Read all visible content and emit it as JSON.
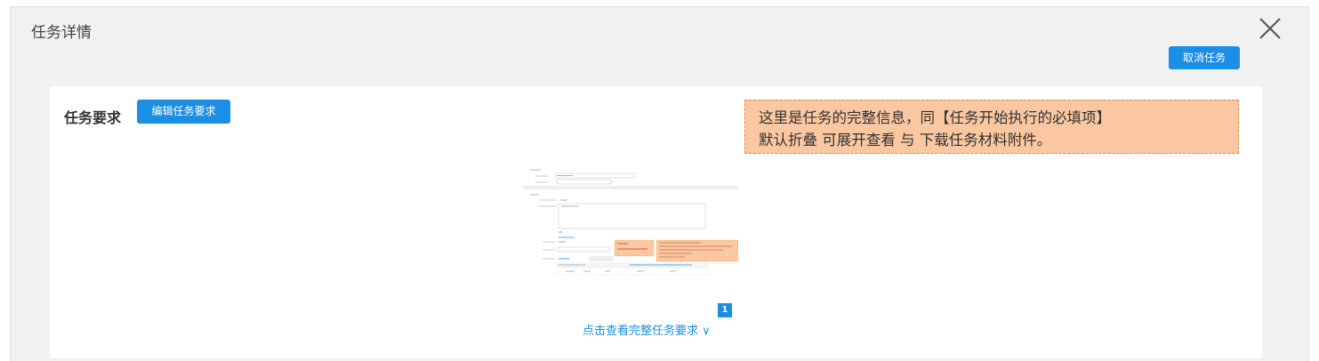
{
  "dialog": {
    "title": "任务详情",
    "cancel_label": "取消任务",
    "close_icon": "close-icon"
  },
  "requirements": {
    "title": "任务要求",
    "edit_label": "编辑任务要求",
    "note_line1": "这里是任务的完整信息，同【任务开始执行的必填项】",
    "note_line2": "默认折叠 可展开查看 与 下载任务材料附件。",
    "page_number": "1",
    "expand_label": "点击查看完整任务要求 ∨"
  },
  "colors": {
    "accent": "#1b8ee6",
    "note_bg": "#fbc7a0",
    "note_border": "#d8914f",
    "modal_bg": "#f1f1f1"
  }
}
